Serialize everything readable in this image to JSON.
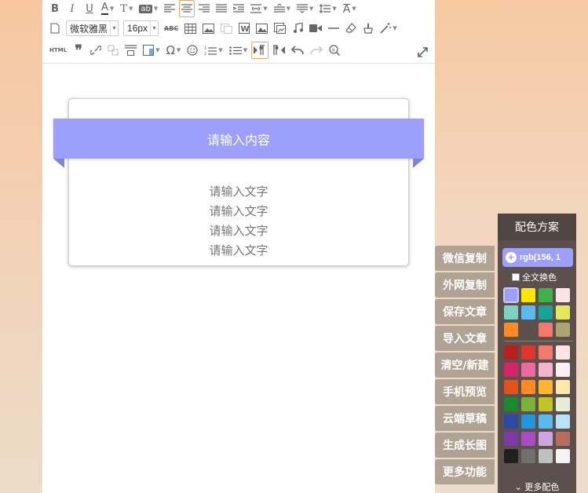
{
  "toolbar": {
    "font_family": "微软雅黑",
    "font_size": "16px",
    "html_label": "HTML",
    "omega": "Ω",
    "abc": "ABC"
  },
  "content": {
    "title": "请输入内容",
    "lines": [
      "请输入文字",
      "请输入文字",
      "请输入文字",
      "请输入文字"
    ]
  },
  "side_menu": [
    "微信复制",
    "外网复制",
    "保存文章",
    "导入文章",
    "清空/新建",
    "手机预览",
    "云端草稿",
    "生成长图",
    "更多功能"
  ],
  "palette": {
    "title": "配色方案",
    "current": "rgb(156, 1",
    "all_text_label": "全文换色",
    "more_label": "更多配色",
    "accent": "#9ca0fc",
    "group1": [
      "#9ca0fc",
      "#ffe600",
      "#3bb34a",
      "#fde4e4",
      "#7dd3c0",
      "#5ab9ef",
      "#16a39a",
      "#e3e85a",
      "#ff8a23",
      "#5b504c",
      "#f37a6b",
      "#aaa56c"
    ],
    "group2": [
      "#b8201b",
      "#e0342b",
      "#f37a6b",
      "#fde4e4",
      "#d6246a",
      "#ee6a9c",
      "#f4b4cd",
      "#fdeef3",
      "#e4521c",
      "#ff8a23",
      "#ffb52e",
      "#fde8aa",
      "#168a2d",
      "#7ab136",
      "#c2c521",
      "#e3eed4",
      "#2b4aa6",
      "#1f97e0",
      "#5ab9ef",
      "#b8e2f8",
      "#7b3aa8",
      "#a94cc4",
      "#d1a3e0",
      "#b66f5c",
      "#202020",
      "#707070",
      "#c0c0c0",
      "#f4f4f4"
    ]
  }
}
